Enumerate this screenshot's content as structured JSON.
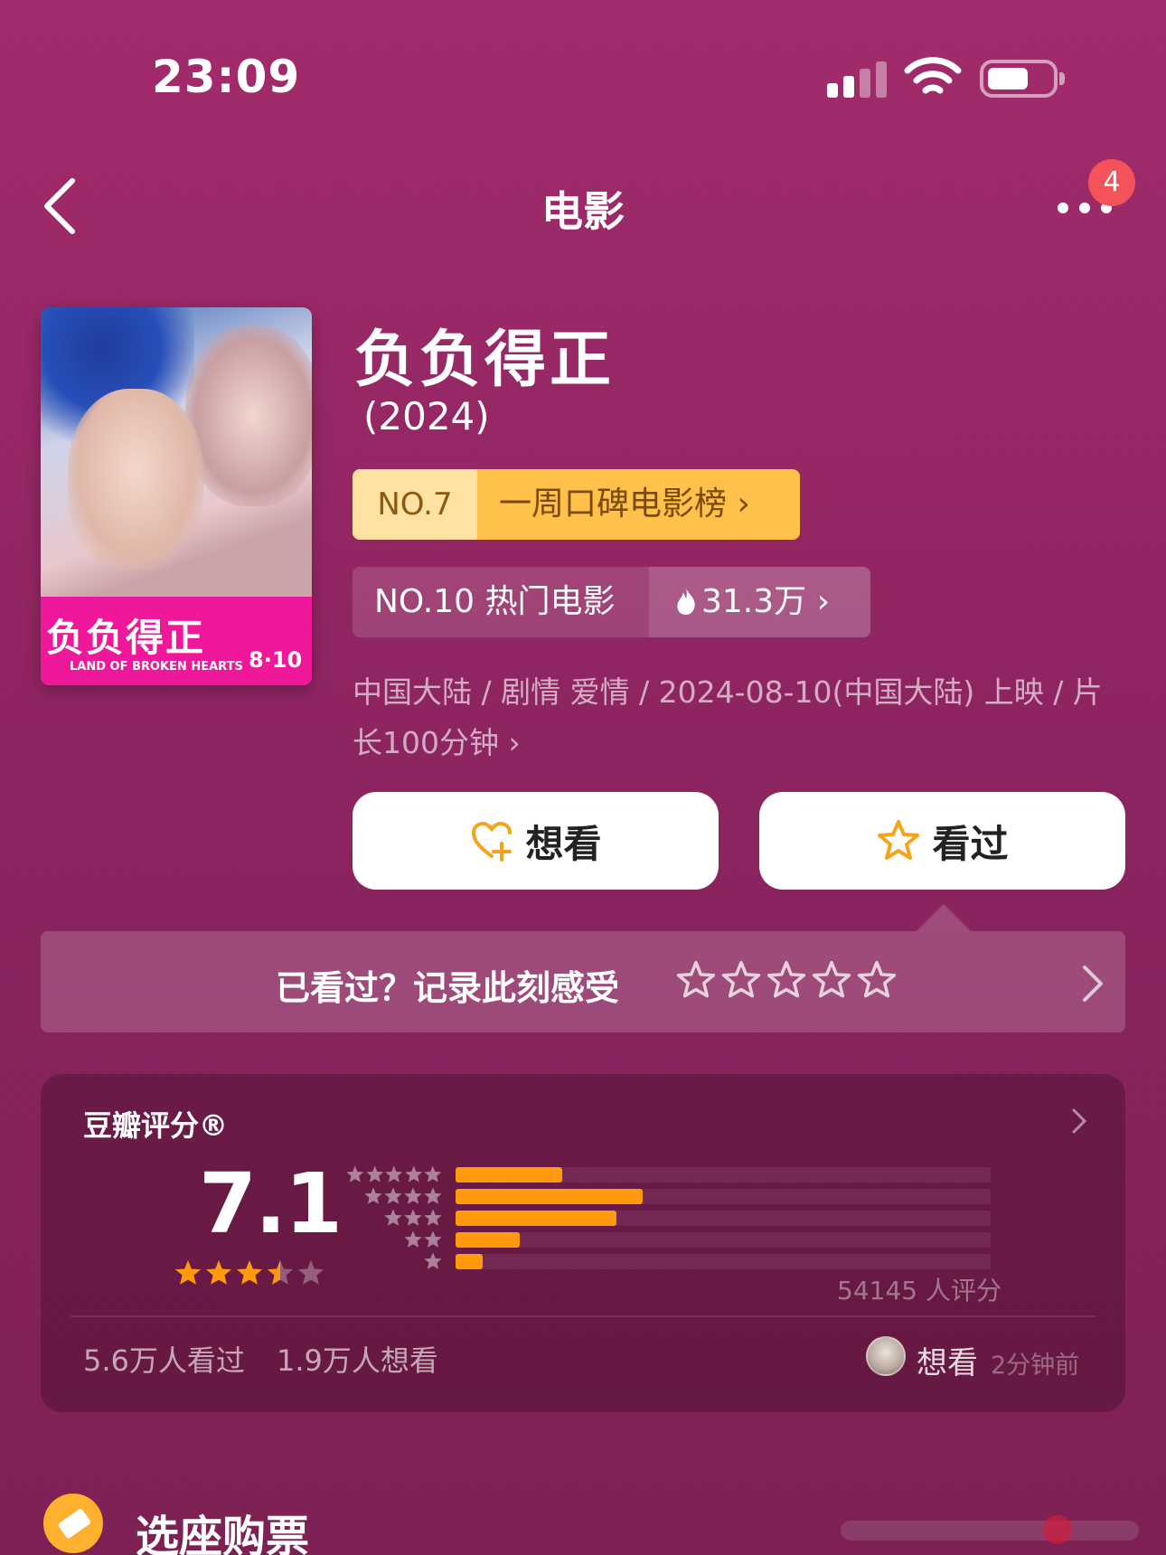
{
  "status_bar": {
    "time": "23:09"
  },
  "nav": {
    "title": "电影",
    "badge_count": "4"
  },
  "poster": {
    "title_art": "负负得正",
    "subtitle": "LAND OF BROKEN HEARTS",
    "date": "8·10"
  },
  "movie": {
    "title": "负负得正",
    "year": "(2024)",
    "meta": "中国大陆 / 剧情 爱情 / 2024-08-10(中国大陆) 上映 / 片长100分钟 ›"
  },
  "ranks": {
    "weekly_no": "NO.7",
    "weekly_label": "一周口碑电影榜 ›",
    "hot_no": "NO.10 热门电影",
    "hot_value": "31.3万 ›"
  },
  "actions": {
    "want_label": "想看",
    "seen_label": "看过"
  },
  "rate_prompt": {
    "text": "已看过？记录此刻感受",
    "stars": 5
  },
  "rating": {
    "title": "豆瓣评分®",
    "score": "7.1",
    "stars_out_of_5": 3.5,
    "distribution_fraction": [
      0.2,
      0.35,
      0.3,
      0.12,
      0.05
    ],
    "raters": "54145 人评分",
    "seen_count": "5.6万人看过",
    "wish_count": "1.9万人想看",
    "friend_action": "想看",
    "friend_time": "2分钟前"
  },
  "ticket": {
    "title": "选座购票"
  },
  "colors": {
    "accent_orange": "#ff9a0e",
    "badge_red": "#f4535c",
    "gold_tag": "#ffc14a"
  }
}
